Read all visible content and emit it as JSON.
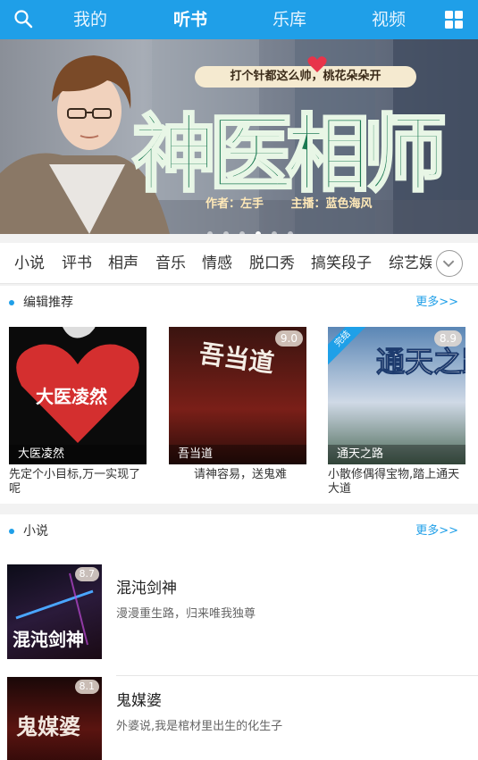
{
  "nav": {
    "tabs": [
      "我的",
      "听书",
      "乐库",
      "视频"
    ],
    "active_tab": "听书",
    "search_icon": "search-icon",
    "grid_icon": "grid-menu-icon"
  },
  "banner": {
    "tagline": "打个针都这么帅，桃花朵朵开",
    "title": "神医相师",
    "author": "作者：左手",
    "narrator": "主播：蓝色海风",
    "slide_count": 6,
    "active_slide": 4
  },
  "categories": [
    "小说",
    "评书",
    "相声",
    "音乐",
    "情感",
    "脱口秀",
    "搞笑段子",
    "综艺娱"
  ],
  "editor_picks": {
    "title": "编辑推荐",
    "more": "更多>>",
    "items": [
      {
        "caption": "大医凌然",
        "cover_title": "大医凌然",
        "desc": "先定个小目标,万一实现了呢",
        "score": ""
      },
      {
        "caption": "吾当道",
        "cover_title": "吾当道",
        "desc": "请神容易，送鬼难",
        "score": "9.0"
      },
      {
        "caption": "通天之路",
        "cover_title": "通天之路",
        "desc": "小散修偶得宝物,踏上通天大道",
        "score": "8.9",
        "badge": "完结"
      }
    ]
  },
  "novels": {
    "title": "小说",
    "more": "更多>>",
    "items": [
      {
        "name": "混沌剑神",
        "sub": "漫漫重生路，归来唯我独尊",
        "score": "8.7",
        "cover_title": "混沌剑神"
      },
      {
        "name": "鬼媒婆",
        "sub": "外婆说,我是棺材里出生的化生子",
        "score": "8.1",
        "cover_title": "鬼媒婆"
      }
    ]
  },
  "colors": {
    "accent": "#1f9fe8",
    "title_green": "#1b7a52"
  }
}
